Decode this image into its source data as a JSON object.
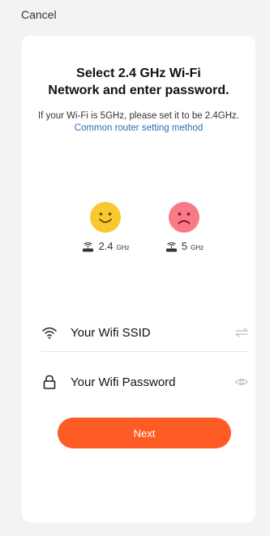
{
  "header": {
    "cancel_label": "Cancel"
  },
  "card": {
    "title_line1": "Select 2.4 GHz Wi-Fi",
    "title_line2": "Network and enter password.",
    "subtitle_text": "If your Wi-Fi is 5GHz, please set it to be 2.4GHz.",
    "subtitle_link": "Common router setting method"
  },
  "bands": [
    {
      "number": "2.4",
      "unit": "GHz",
      "face": "happy-face-icon",
      "face_color": "#f8c830"
    },
    {
      "number": "5",
      "unit": "GHz",
      "face": "sad-face-icon",
      "face_color": "#f77a86"
    }
  ],
  "form": {
    "ssid_placeholder": "Your Wifi SSID",
    "password_placeholder": "Your Wifi Password",
    "ssid_icon": "wifi-icon",
    "password_icon": "lock-icon",
    "switch_icon": "switch-arrows-icon",
    "eye_icon": "eye-icon"
  },
  "actions": {
    "next_label": "Next"
  },
  "colors": {
    "accent": "#ff5c25",
    "link": "#2a6fb6",
    "background": "#f3f3f3"
  }
}
